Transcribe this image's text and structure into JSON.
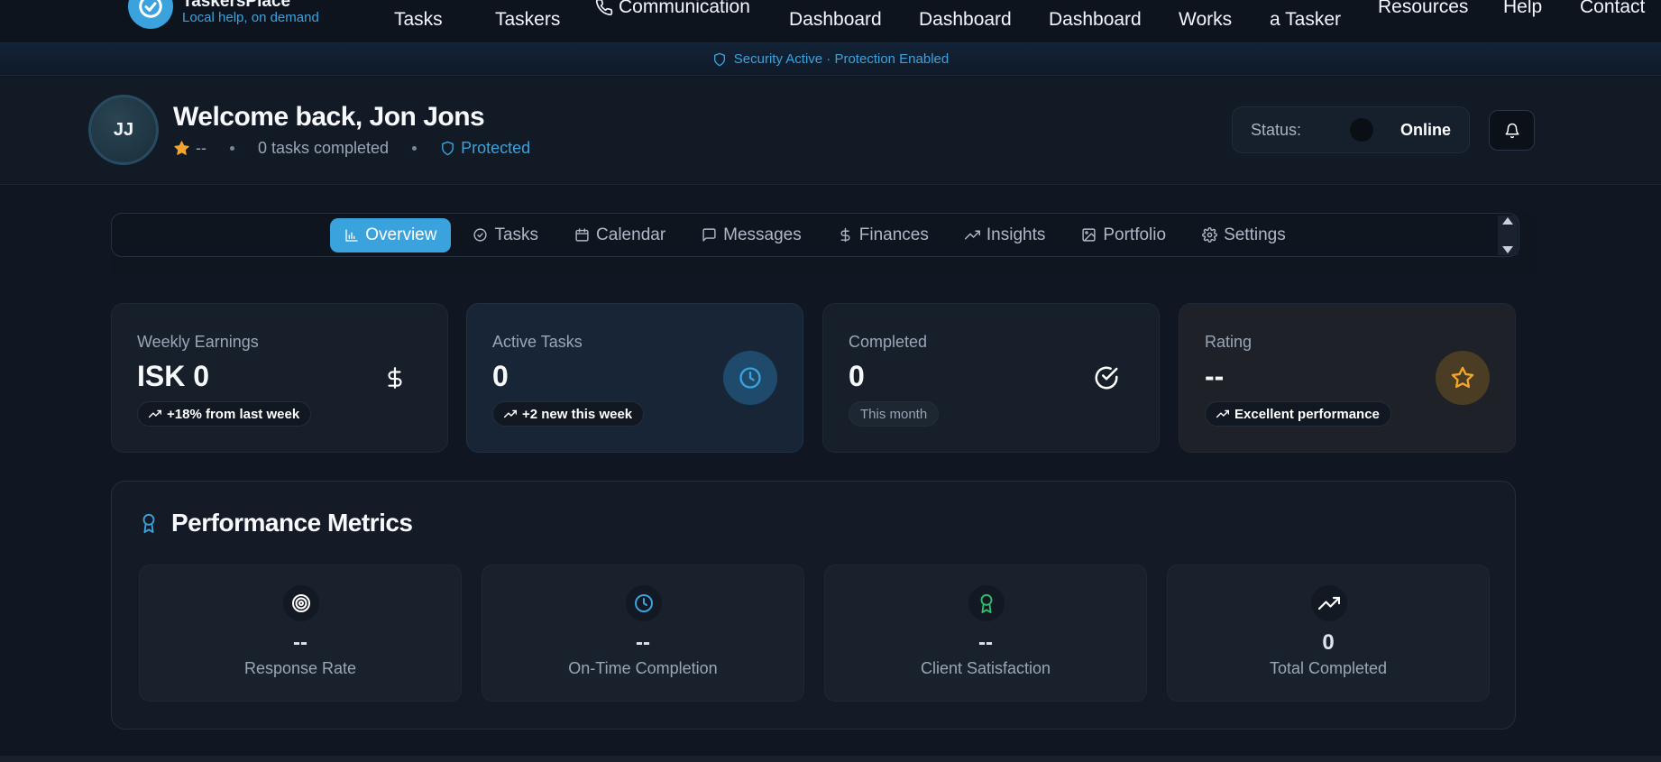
{
  "brand": {
    "name": "TaskersPlace",
    "tagline": "Local help, on demand"
  },
  "nav": {
    "items": [
      {
        "top": "",
        "label": "Tasks"
      },
      {
        "top": "",
        "label": "Taskers"
      },
      {
        "top": "",
        "label": "Communication"
      },
      {
        "top": "",
        "label": "Dashboard"
      },
      {
        "top": "",
        "label": "Dashboard"
      },
      {
        "top": "",
        "label": "Dashboard"
      },
      {
        "top": "",
        "label": "Works"
      },
      {
        "top": "",
        "label": "a Tasker"
      },
      {
        "top": "",
        "label": "Resources"
      },
      {
        "top": "",
        "label": "Help"
      },
      {
        "top": "",
        "label": "Contact"
      }
    ]
  },
  "security_bar": {
    "text": "Security Active · Protection Enabled"
  },
  "welcome": {
    "initials": "JJ",
    "title": "Welcome back, Jon Jons",
    "rating": "--",
    "tasks_completed": "0 tasks completed",
    "protected": "Protected"
  },
  "status": {
    "label": "Status:",
    "value": "Online"
  },
  "tabs": [
    {
      "label": "Overview",
      "icon": "bar-chart-icon"
    },
    {
      "label": "Tasks",
      "icon": "check-circle-icon"
    },
    {
      "label": "Calendar",
      "icon": "calendar-icon"
    },
    {
      "label": "Messages",
      "icon": "message-icon"
    },
    {
      "label": "Finances",
      "icon": "dollar-icon"
    },
    {
      "label": "Insights",
      "icon": "trending-up-icon"
    },
    {
      "label": "Portfolio",
      "icon": "image-icon"
    },
    {
      "label": "Settings",
      "icon": "gear-icon"
    }
  ],
  "stats": [
    {
      "label": "Weekly Earnings",
      "value": "ISK 0",
      "pill": "+18% from last week",
      "icon": "dollar-icon"
    },
    {
      "label": "Active Tasks",
      "value": "0",
      "pill": "+2 new this week",
      "icon": "clock-icon"
    },
    {
      "label": "Completed",
      "value": "0",
      "pill": "This month",
      "icon": "check-circle-icon"
    },
    {
      "label": "Rating",
      "value": "--",
      "pill": "Excellent performance",
      "icon": "star-icon"
    }
  ],
  "performance": {
    "title": "Performance Metrics",
    "metrics": [
      {
        "value": "--",
        "label": "Response Rate",
        "icon": "target-icon"
      },
      {
        "value": "--",
        "label": "On-Time Completion",
        "icon": "clock-icon"
      },
      {
        "value": "--",
        "label": "Client Satisfaction",
        "icon": "award-icon"
      },
      {
        "value": "0",
        "label": "Total Completed",
        "icon": "trending-up-icon"
      }
    ]
  },
  "colors": {
    "accent": "#3aa3de",
    "gold": "#f4a52a",
    "success": "#2fbf71"
  }
}
